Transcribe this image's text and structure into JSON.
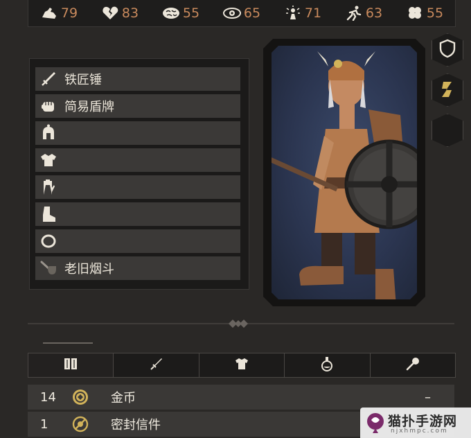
{
  "stats": [
    {
      "icon": "strength-icon",
      "value": "79"
    },
    {
      "icon": "broken-heart-icon",
      "value": "83"
    },
    {
      "icon": "brain-icon",
      "value": "55"
    },
    {
      "icon": "eye-icon",
      "value": "65"
    },
    {
      "icon": "spark-icon",
      "value": "71"
    },
    {
      "icon": "runner-icon",
      "value": "63"
    },
    {
      "icon": "clover-icon",
      "value": "55"
    }
  ],
  "equipment": [
    {
      "icon": "sword-icon",
      "label": "铁匠锤"
    },
    {
      "icon": "fist-icon",
      "label": "简易盾牌"
    },
    {
      "icon": "helmet-icon",
      "label": ""
    },
    {
      "icon": "armor-icon",
      "label": ""
    },
    {
      "icon": "glove-icon",
      "label": ""
    },
    {
      "icon": "boot-icon",
      "label": ""
    },
    {
      "icon": "ring-icon",
      "label": ""
    },
    {
      "icon": "pipe-icon",
      "label": "老旧烟斗"
    }
  ],
  "side_buttons": [
    "shield-icon",
    "gold-item-icon",
    "empty-slot-icon"
  ],
  "tabs": [
    "all-items-icon",
    "weapon-icon",
    "armor-icon",
    "potion-icon",
    "wand-icon"
  ],
  "inventory": [
    {
      "qty": "14",
      "icon": "coin-icon",
      "name": "金币",
      "dash": "–"
    },
    {
      "qty": "1",
      "icon": "sealed-letter-icon",
      "name": "密封信件",
      "dash": ""
    }
  ],
  "watermark": {
    "text": "猫扑手游网",
    "domain": "njxhmpc.com"
  },
  "colors": {
    "stat_value": "#c98a5d",
    "accent_gold": "#d2b35a",
    "panel": "#3b3937"
  }
}
